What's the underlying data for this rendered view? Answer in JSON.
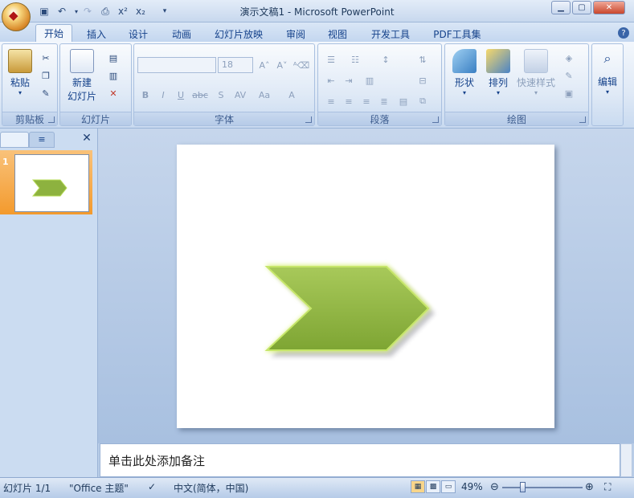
{
  "window": {
    "title": "演示文稿1 - Microsoft PowerPoint"
  },
  "tabs": [
    {
      "label": "开始"
    },
    {
      "label": "插入"
    },
    {
      "label": "设计"
    },
    {
      "label": "动画"
    },
    {
      "label": "幻灯片放映"
    },
    {
      "label": "审阅"
    },
    {
      "label": "视图"
    },
    {
      "label": "开发工具"
    },
    {
      "label": "PDF工具集"
    }
  ],
  "ribbon": {
    "clipboard": {
      "label": "剪贴板",
      "paste": "粘贴"
    },
    "slides": {
      "label": "幻灯片",
      "new_slide_line1": "新建",
      "new_slide_line2": "幻灯片"
    },
    "font": {
      "label": "字体",
      "size_value": "18"
    },
    "paragraph": {
      "label": "段落"
    },
    "drawing": {
      "label": "绘图",
      "shapes": "形状",
      "arrange": "排列",
      "quick_styles": "快速样式"
    },
    "editing": {
      "label": "编辑"
    }
  },
  "panel": {
    "slide_number": "1"
  },
  "notes": {
    "placeholder": "单击此处添加备注"
  },
  "status": {
    "slide_info": "幻灯片 1/1",
    "theme": "\"Office 主题\"",
    "language": "中文(简体，中国)",
    "zoom": "49%"
  },
  "colors": {
    "accent": "#15428b",
    "arrow_fill": "#8db23f",
    "arrow_glow": "#d8f07a",
    "thumb_selected": "#f39a2d"
  }
}
